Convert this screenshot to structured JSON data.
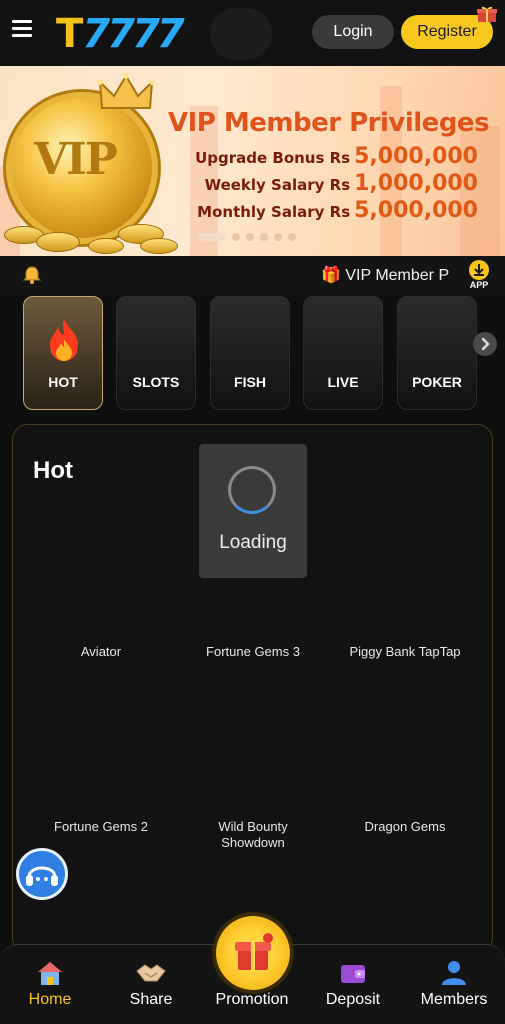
{
  "header": {
    "logo_text_t": "T",
    "logo_text_rest": "7777",
    "login_label": "Login",
    "register_label": "Register"
  },
  "banner": {
    "title": "VIP Member Privileges",
    "coin_text": "VIP",
    "rows": [
      {
        "label": "Upgrade Bonus Rs",
        "value": "5,000,000"
      },
      {
        "label": "Weekly Salary Rs",
        "value": "1,000,000"
      },
      {
        "label": "Monthly Salary Rs",
        "value": "5,000,000"
      }
    ],
    "slide_count": 6,
    "active_slide": 1
  },
  "marquee": {
    "text": "🎁 VIP Member P",
    "app_label": "APP"
  },
  "categories": [
    {
      "label": "HOT",
      "active": true
    },
    {
      "label": "SLOTS",
      "active": false
    },
    {
      "label": "FISH",
      "active": false
    },
    {
      "label": "LIVE",
      "active": false
    },
    {
      "label": "POKER",
      "active": false
    }
  ],
  "panel": {
    "title": "Hot",
    "loading_text": "Loading",
    "games": [
      {
        "name": "Aviator"
      },
      {
        "name": "Fortune Gems 3"
      },
      {
        "name": "Piggy Bank TapTap"
      },
      {
        "name": "Fortune Gems 2"
      },
      {
        "name": "Wild Bounty Showdown"
      },
      {
        "name": "Dragon Gems"
      }
    ]
  },
  "bottom_nav": [
    {
      "label": "Home",
      "icon": "home-icon",
      "active": true
    },
    {
      "label": "Share",
      "icon": "handshake-icon",
      "active": false
    },
    {
      "label": "Promotion",
      "icon": "gift-icon",
      "active": false
    },
    {
      "label": "Deposit",
      "icon": "wallet-icon",
      "active": false
    },
    {
      "label": "Members",
      "icon": "user-icon",
      "active": false
    }
  ],
  "colors": {
    "accent": "#f5c518",
    "background": "#0f0f0f",
    "banner_text": "#e0541b"
  }
}
